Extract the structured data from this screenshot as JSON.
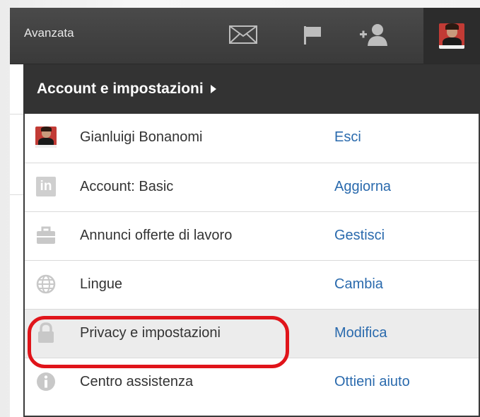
{
  "topbar": {
    "label": "Avanzata",
    "icons": [
      "envelope-icon",
      "flag-icon",
      "add-contact-icon"
    ]
  },
  "dropdown": {
    "title": "Account e impostazioni",
    "items": [
      {
        "label": "Gianluigi Bonanomi",
        "action": "Esci",
        "icon": "profile-avatar"
      },
      {
        "label": "Account: Basic",
        "action": "Aggiorna",
        "icon": "linkedin-icon"
      },
      {
        "label": "Annunci offerte di lavoro",
        "action": "Gestisci",
        "icon": "briefcase-icon"
      },
      {
        "label": "Lingue",
        "action": "Cambia",
        "icon": "globe-icon"
      },
      {
        "label": "Privacy e impostazioni",
        "action": "Modifica",
        "icon": "lock-icon"
      },
      {
        "label": "Centro assistenza",
        "action": "Ottieni aiuto",
        "icon": "info-icon"
      }
    ]
  },
  "linkedin_logo_text": "in",
  "colors": {
    "topbar": "#3f3f3f",
    "header": "#333333",
    "link": "#2a6aad",
    "highlight_ring": "#e0141a",
    "icon_gray": "#c8c8c8"
  }
}
